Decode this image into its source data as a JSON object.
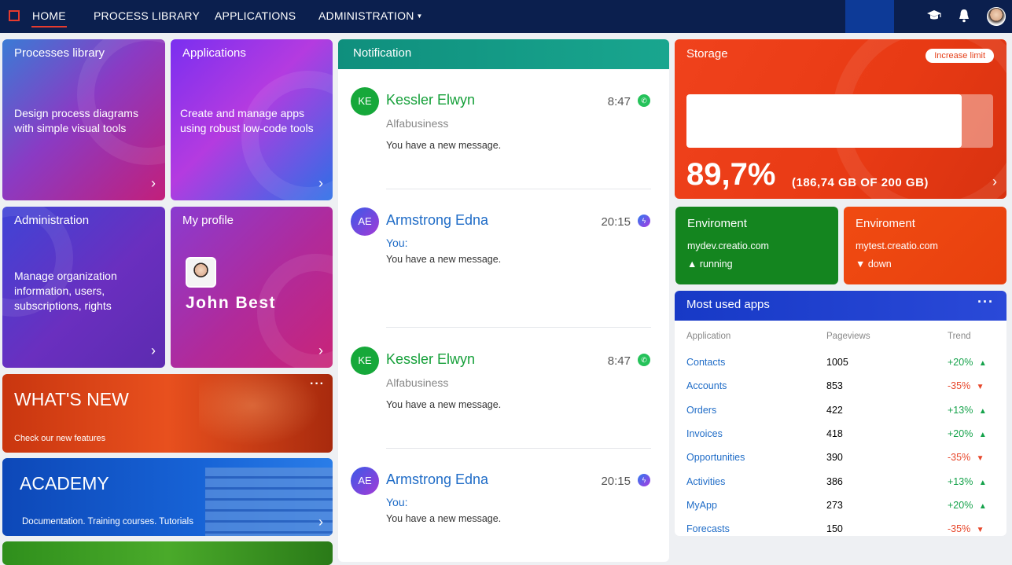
{
  "nav": {
    "home": "HOME",
    "process": "PROCESS LIBRARY",
    "apps": "APPLICATIONS",
    "admin": "ADMINISTRATION"
  },
  "tiles": {
    "processes": {
      "title": "Processes library",
      "desc": "Design process diagrams with simple visual tools"
    },
    "applications": {
      "title": "Applications",
      "desc": "Create and manage apps using robust low-code tools"
    },
    "administration": {
      "title": "Administration",
      "desc": "Manage organization information, users, subscriptions, rights"
    },
    "profile": {
      "title": "My profile",
      "name": "John Best"
    },
    "whats_new": {
      "title": "WHAT'S NEW",
      "sub": "Check our new features",
      "menu": "···"
    },
    "academy": {
      "title": "ACADEMY",
      "sub": "Documentation. Training courses. Tutorials"
    }
  },
  "notification": {
    "title": "Notification",
    "messages": [
      {
        "initials": "KE",
        "name": "Kessler Elwyn",
        "time": "8:47",
        "sub": "Alfabusiness",
        "text": "You have a new message.",
        "channel": "whatsapp-icon"
      },
      {
        "initials": "AE",
        "name": "Armstrong Edna",
        "time": "20:15",
        "sub": "You:",
        "text": "You have a new message.",
        "channel": "messenger-icon"
      },
      {
        "initials": "KE",
        "name": "Kessler Elwyn",
        "time": "8:47",
        "sub": "Alfabusiness",
        "text": "You have a new message.",
        "channel": "whatsapp-icon"
      },
      {
        "initials": "AE",
        "name": "Armstrong Edna",
        "time": "20:15",
        "sub": "You:",
        "text": "You have a new message.",
        "channel": "messenger-icon"
      }
    ]
  },
  "storage": {
    "title": "Storage",
    "button": "Increase limit",
    "percent": "89,7%",
    "detail": "(186,74 GB OF 200 GB)",
    "used_fraction": 0.897
  },
  "environments": [
    {
      "title": "Enviroment",
      "host": "mydev.creatio.com",
      "status": "running",
      "color": "#14851f"
    },
    {
      "title": "Enviroment",
      "host": "mytest.creatio.com",
      "status": "down",
      "color": "#f04b12"
    }
  ],
  "most_used": {
    "title": "Most used apps",
    "menu": "···",
    "columns": [
      "Application",
      "Pageviews",
      "Trend"
    ],
    "rows": [
      {
        "app": "Contacts",
        "views": "1005",
        "trend": "+20%",
        "dir": "up"
      },
      {
        "app": "Accounts",
        "views": "853",
        "trend": "-35%",
        "dir": "down"
      },
      {
        "app": "Orders",
        "views": "422",
        "trend": "+13%",
        "dir": "up"
      },
      {
        "app": "Invoices",
        "views": "418",
        "trend": "+20%",
        "dir": "up"
      },
      {
        "app": "Opportunities",
        "views": "390",
        "trend": "-35%",
        "dir": "down"
      },
      {
        "app": "Activities",
        "views": "386",
        "trend": "+13%",
        "dir": "up"
      },
      {
        "app": "MyApp",
        "views": "273",
        "trend": "+20%",
        "dir": "up"
      },
      {
        "app": "Forecasts",
        "views": "150",
        "trend": "-35%",
        "dir": "down"
      }
    ]
  },
  "colors": {
    "nav": "#0b1f4e",
    "accent_red": "#e63b2e",
    "green_avatar": "#16a83a",
    "link": "#1f6cc7"
  }
}
